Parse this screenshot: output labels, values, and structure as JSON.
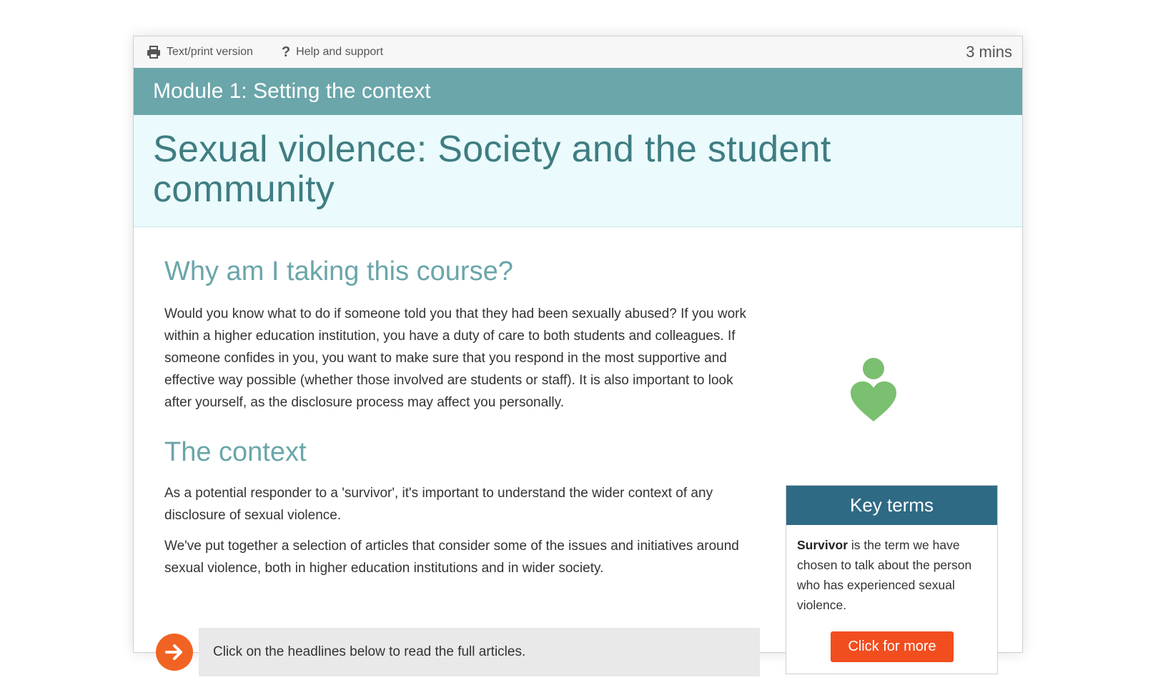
{
  "topbar": {
    "print_label": "Text/print version",
    "help_label": "Help and support",
    "help_glyph": "?",
    "duration": "3 mins"
  },
  "module": {
    "title": "Module 1: Setting the context"
  },
  "page": {
    "title": "Sexual violence: Society and the student community"
  },
  "sections": [
    {
      "heading": "Why am I taking this course?",
      "paragraphs": [
        "Would you know what to do if someone told you that they had been sexually abused? If you work within a higher education institution, you have a duty of care to both students and colleagues. If someone confides in you, you want to make sure that you respond in the most supportive and effective way possible (whether those involved are students or staff). It is also important to look after yourself, as the disclosure process may affect you personally."
      ]
    },
    {
      "heading": "The context",
      "paragraphs": [
        "As a potential responder to a 'survivor', it's important to understand the wider context of any disclosure of sexual violence.",
        "We've put together a selection of articles that consider some of the issues and initiatives around sexual violence, both in higher education institutions and in wider society."
      ]
    }
  ],
  "cta": {
    "text": "Click on the headlines below to read the full articles."
  },
  "key_terms": {
    "header": "Key terms",
    "term": "Survivor",
    "definition": " is the term we have chosen to talk about the person who has experienced sexual violence.",
    "button_label": "Click for more"
  },
  "colors": {
    "module_bar": "#6aa6aa",
    "title_band": "#ebfbfd",
    "title_text": "#3f7d82",
    "key_terms_header": "#2f6a85",
    "button": "#f24d1f",
    "arrow": "#f16322",
    "figure": "#7bbf70"
  },
  "icons": {
    "print": "printer-icon",
    "help": "question-icon",
    "arrow": "arrow-right-icon",
    "figure": "person-heart-icon"
  }
}
